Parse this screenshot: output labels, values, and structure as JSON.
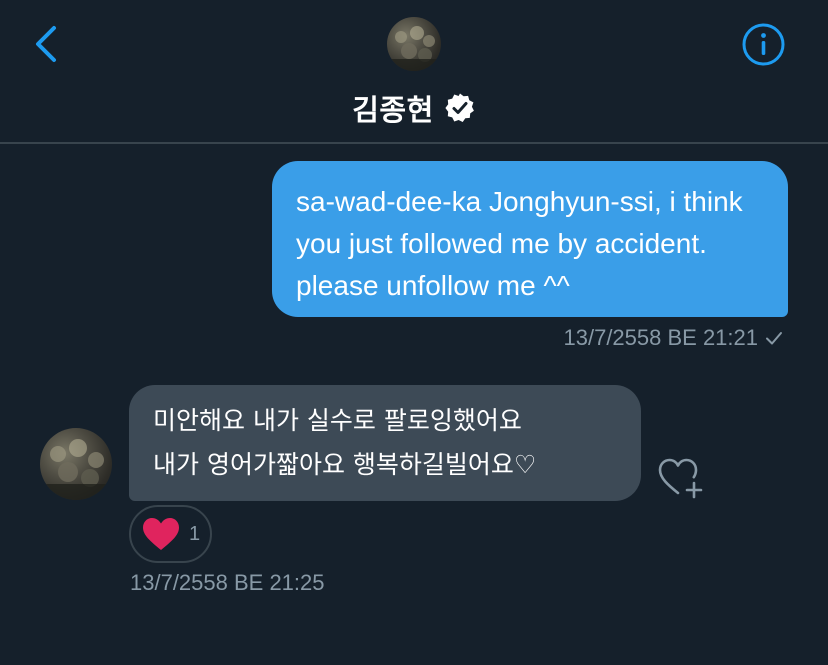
{
  "header": {
    "back_icon": "chevron-left-icon",
    "title": "김종현",
    "verified_icon": "verified-badge-icon",
    "info_icon": "info-icon"
  },
  "messages": [
    {
      "direction": "outgoing",
      "text": "sa-wad-dee-ka Jonghyun-ssi, i think you just followed me by accident. please unfollow me ^^",
      "timestamp": "13/7/2558 BE 21:21",
      "status_icon": "sent-check-icon"
    },
    {
      "direction": "incoming",
      "lines": [
        "미안해요 내가 실수로 팔로잉했어요",
        "내가 영어가짧아요 행복하길빌어요♡"
      ],
      "timestamp": "13/7/2558 BE 21:25",
      "reaction": {
        "icon": "heart-icon",
        "count": "1"
      },
      "add_reaction_icon": "add-reaction-heart-icon"
    }
  ],
  "colors": {
    "background": "#15202b",
    "outgoing_bubble": "#3a9ee8",
    "incoming_bubble": "#3d4a56",
    "accent": "#1d9bf0",
    "muted_text": "#8899a6",
    "reaction_heart": "#e0245e"
  }
}
